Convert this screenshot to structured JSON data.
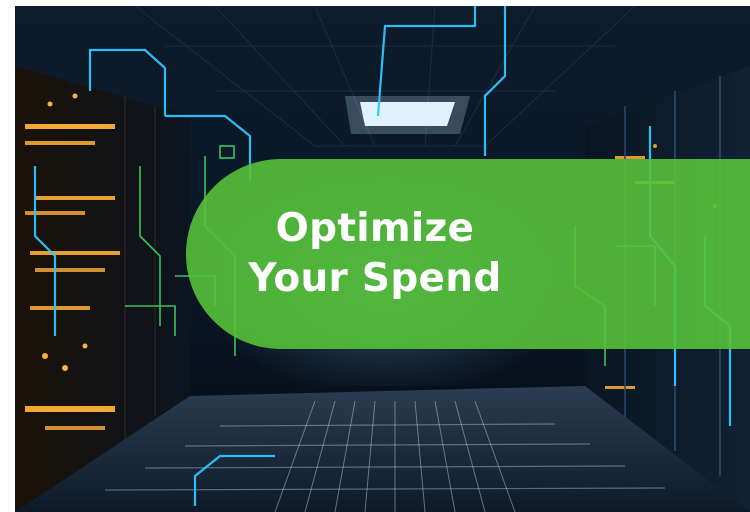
{
  "banner": {
    "line1": "Optimize",
    "line2": "Your Spend"
  },
  "colors": {
    "banner_green": "#55c13a",
    "banner_text": "#ffffff",
    "circuit_blue": "#2fc6ff",
    "server_amber": "#ffb03a",
    "circuit_green": "#45e06a"
  },
  "photo": {
    "subject": "data-center-server-aisle",
    "icons": [
      "server-rack-left",
      "server-rack-right",
      "ceiling-light",
      "floor-grate",
      "circuit-lines"
    ]
  }
}
